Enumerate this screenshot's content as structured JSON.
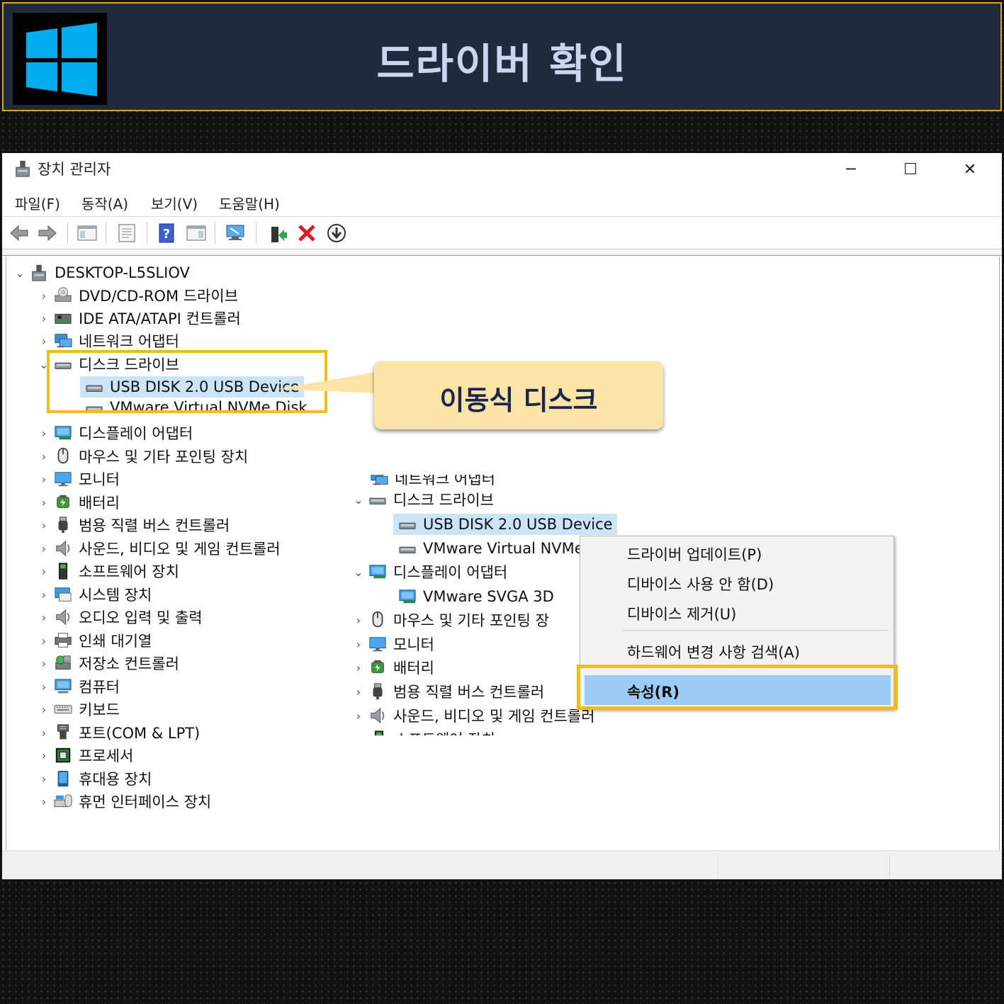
{
  "banner": {
    "title": "드라이버 확인"
  },
  "window": {
    "title": "장치 관리자",
    "controls": {
      "minimize": "─",
      "maximize": "☐",
      "close": "✕"
    },
    "menu": [
      "파일(F)",
      "동작(A)",
      "보기(V)",
      "도움말(H)"
    ]
  },
  "tree": {
    "root": "DESKTOP-L5SLIOV",
    "items": [
      {
        "label": "DVD/CD-ROM 드라이브",
        "icon": "dvd-drive-icon"
      },
      {
        "label": "IDE ATA/ATAPI 컨트롤러",
        "icon": "ide-controller-icon"
      },
      {
        "label": "네트워크 어댑터",
        "icon": "network-adapter-icon"
      },
      {
        "label": "디스크 드라이브",
        "icon": "disk-drive-icon"
      },
      {
        "label": "USB DISK 2.0 USB Device",
        "icon": "disk-drive-icon"
      },
      {
        "label": "VMware Virtual NVMe Disk",
        "icon": "disk-drive-icon"
      },
      {
        "label": "디스플레이 어댑터",
        "icon": "display-adapter-icon"
      },
      {
        "label": "마우스 및 기타 포인팅 장치",
        "icon": "mouse-icon"
      },
      {
        "label": "모니터",
        "icon": "monitor-icon"
      },
      {
        "label": "배터리",
        "icon": "battery-icon"
      },
      {
        "label": "범용 직렬 버스 컨트롤러",
        "icon": "usb-icon"
      },
      {
        "label": "사운드, 비디오 및 게임 컨트롤러",
        "icon": "speaker-icon"
      },
      {
        "label": "소프트웨어 장치",
        "icon": "software-device-icon"
      },
      {
        "label": "시스템 장치",
        "icon": "system-device-icon"
      },
      {
        "label": "오디오 입력 및 출력",
        "icon": "speaker-icon"
      },
      {
        "label": "인쇄 대기열",
        "icon": "printer-icon"
      },
      {
        "label": "저장소 컨트롤러",
        "icon": "storage-controller-icon"
      },
      {
        "label": "컴퓨터",
        "icon": "computer-icon"
      },
      {
        "label": "키보드",
        "icon": "keyboard-icon"
      },
      {
        "label": "포트(COM & LPT)",
        "icon": "port-icon"
      },
      {
        "label": "프로세서",
        "icon": "processor-icon"
      },
      {
        "label": "휴대용 장치",
        "icon": "portable-device-icon"
      },
      {
        "label": "휴먼 인터페이스 장치",
        "icon": "hid-icon"
      }
    ]
  },
  "callout": {
    "text": "이동식 디스크"
  },
  "overlay_tree": {
    "items": [
      {
        "label": "네트워크 어댑터"
      },
      {
        "label": "디스크 드라이브"
      },
      {
        "label": "USB DISK 2.0 USB Device"
      },
      {
        "label": "VMware Virtual NVMe"
      },
      {
        "label": "디스플레이 어댑터"
      },
      {
        "label": "VMware SVGA 3D"
      },
      {
        "label": "마우스 및 기타 포인팅 장"
      },
      {
        "label": "모니터"
      },
      {
        "label": "배터리"
      },
      {
        "label": "범용 직렬 버스 컨트롤러"
      },
      {
        "label": "사운드, 비디오 및 게임 컨트롤러"
      },
      {
        "label": "소프트웨어 장치"
      }
    ]
  },
  "context_menu": {
    "items": [
      "드라이버 업데이트(P)",
      "디바이스 사용 안 함(D)",
      "디바이스 제거(U)",
      "하드웨어 변경 사항 검색(A)",
      "속성(R)"
    ]
  },
  "colors": {
    "banner_bg": "#1f2a3c",
    "highlight": "#f5bd13",
    "callout_bg": "#fbe4a5",
    "selection": "#cce4f7",
    "menu_active": "#9ccbf5"
  }
}
